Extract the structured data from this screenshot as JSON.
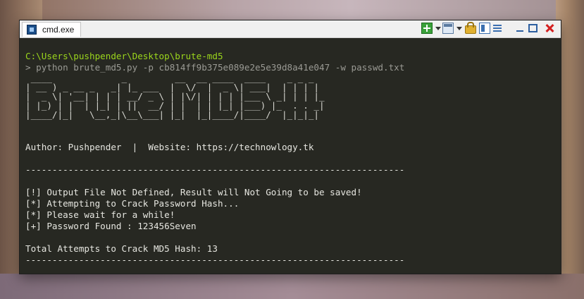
{
  "window": {
    "tab_label": "cmd.exe",
    "icons": [
      "new-console-icon",
      "dropdown-icon",
      "panes-icon",
      "dropdown-icon",
      "lock-icon",
      "view-icon",
      "menu-icon",
      "minimize-icon",
      "maximize-icon",
      "close-icon"
    ]
  },
  "terminal": {
    "prompt_path": "C:\\Users\\pushpender\\Desktop\\brute-md5",
    "command": "> python brute_md5.py -p cb814ff9b375e089e2e5e39d8a41e047 -w passwd.txt",
    "banner": [
      " ____             _         __  __ ____  ____    _ _ _",
      "| __ ) _ __ _   _| |_ ___  |  \\/  |  _ \\| ___|  | | | |",
      "|  _ \\| '__| | | | __/ _ \\ | |\\/| | | | |___ \\ _| | | |_",
      "| |_) | |  | |_| | ||  __/ | |  | | |_| |___) |_  . . _|",
      "|____/|_|   \\__,_|\\__\\___| |_|  |_|____/|____/  |_|_|_|"
    ],
    "author_line": "Author: Pushpender  |  Website: https://technowlogy.tk",
    "separator": "-----------------------------------------------------------------------",
    "messages": [
      "[!] Output File Not Defined, Result will Not Going to be saved!",
      "[*] Attempting to Crack Password Hash...",
      "[*] Please wait for a while!",
      "[+] Password Found : 123456Seven"
    ],
    "total_line": "Total Attempts to Crack MD5 Hash: 13"
  }
}
